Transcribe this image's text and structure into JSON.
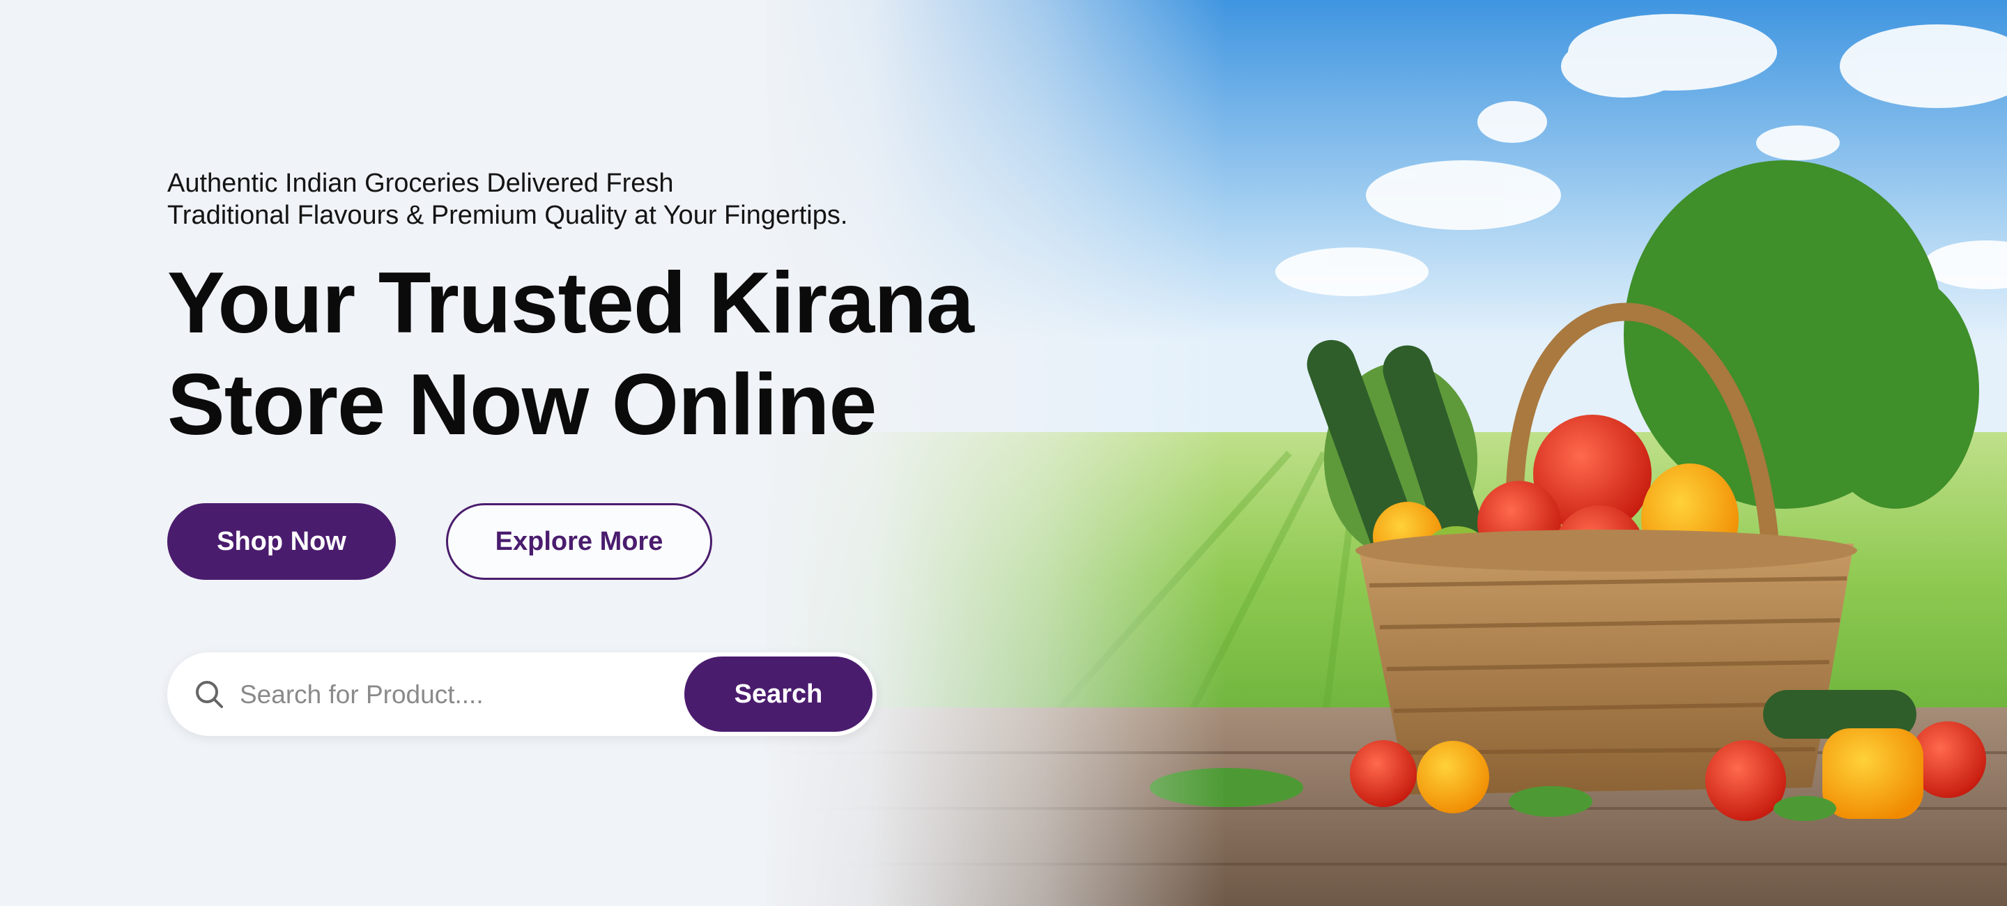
{
  "hero": {
    "tagline_line1": "Authentic Indian Groceries Delivered Fresh",
    "tagline_line2": "Traditional Flavours & Premium Quality at Your Fingertips.",
    "headline_line1": "Your Trusted Kirana",
    "headline_line2": "Store Now Online",
    "shop_now_label": "Shop Now",
    "explore_more_label": "Explore More"
  },
  "search": {
    "placeholder": "Search for Product....",
    "value": "",
    "button_label": "Search",
    "icon": "search-icon"
  },
  "colors": {
    "brand_purple": "#4a1c6e",
    "background": "#f0f3f7",
    "headline": "#0b0b0b"
  }
}
